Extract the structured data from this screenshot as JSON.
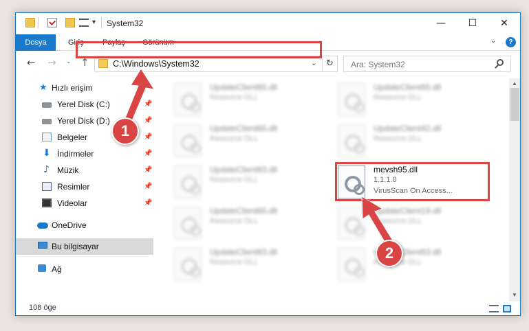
{
  "window": {
    "title": "System32",
    "controls": {
      "minimize": "—",
      "maximize": "☐",
      "close": "✕"
    }
  },
  "quick_access_toolbar": {
    "dropdown": "▾",
    "separator": "|"
  },
  "ribbon": {
    "tabs": [
      {
        "label": "Dosya",
        "active": true
      },
      {
        "label": "Giriş"
      },
      {
        "label": "Paylaş"
      },
      {
        "label": "Görünüm"
      }
    ],
    "collapse": "⌄",
    "help": "?"
  },
  "navigation": {
    "back": "←",
    "forward": "→",
    "recent": "⌄",
    "up": "↑",
    "address": "C:\\Windows\\System32",
    "address_dropdown": "⌄",
    "refresh": "↻",
    "search_placeholder": "Ara: System32"
  },
  "sidebar": {
    "items": [
      {
        "label": "Hızlı erişim",
        "icon": "star-icon"
      },
      {
        "label": "Yerel Disk (C:)",
        "icon": "drive-icon",
        "pinned": true
      },
      {
        "label": "Yerel Disk (D:)",
        "icon": "drive-icon",
        "pinned": true
      },
      {
        "label": "Belgeler",
        "icon": "documents-icon",
        "pinned": true
      },
      {
        "label": "İndirmeler",
        "icon": "download-icon",
        "pinned": true
      },
      {
        "label": "Müzik",
        "icon": "music-icon",
        "pinned": true
      },
      {
        "label": "Resimler",
        "icon": "pictures-icon",
        "pinned": true
      },
      {
        "label": "Videolar",
        "icon": "video-icon",
        "pinned": true
      },
      {
        "label": "OneDrive",
        "icon": "cloud-icon"
      },
      {
        "label": "Bu bilgisayar",
        "icon": "computer-icon",
        "selected": true
      },
      {
        "label": "Ağ",
        "icon": "network-icon"
      }
    ],
    "pin_glyph": "📌"
  },
  "files": [
    {
      "name": "UpdateClient65.dll",
      "type": "Resource DLL"
    },
    {
      "name": "UpdateClient65.dll",
      "type": "Resource DLL"
    },
    {
      "name": "UpdateClient65.dll",
      "type": "Resource DLL"
    },
    {
      "name": "UpdateClient42.dll",
      "type": "Resource DLL"
    },
    {
      "name": "UpdateClient63.dll",
      "type": "Resource DLL"
    },
    {
      "name": "mevsh95.dll",
      "version": "1.1.1.0",
      "description": "VirusScan On Access...",
      "highlighted": true
    },
    {
      "name": "UpdateClient65.dll",
      "type": "Resource DLL"
    },
    {
      "name": "UpdateClient19.dll",
      "type": "Resource DLL"
    },
    {
      "name": "UpdateClient63.dll",
      "type": "Resource DLL"
    },
    {
      "name": "UpdateClient63.dll",
      "type": "Resource DLL"
    }
  ],
  "status": {
    "item_count": "108 öge"
  },
  "annotations": {
    "callout_1": "1",
    "callout_2": "2",
    "highlight_color": "#d94545"
  },
  "colors": {
    "accent": "#1979ca",
    "highlight": "#d94545"
  }
}
